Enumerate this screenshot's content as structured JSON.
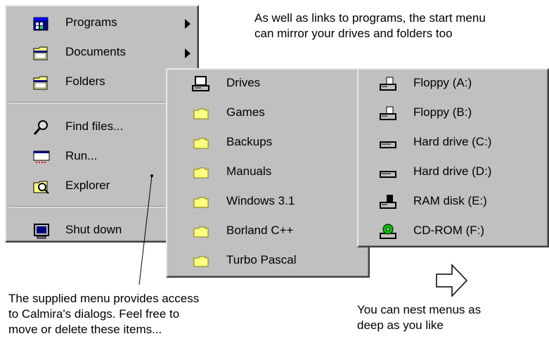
{
  "start_menu": {
    "items": [
      {
        "label": "Programs",
        "icon": "programs-icon"
      },
      {
        "label": "Documents",
        "icon": "documents-icon"
      },
      {
        "label": "Folders",
        "icon": "folders-icon"
      },
      {
        "label": "Find files...",
        "icon": "find-icon"
      },
      {
        "label": "Run...",
        "icon": "run-icon"
      },
      {
        "label": "Explorer",
        "icon": "explorer-icon"
      },
      {
        "label": "Shut down",
        "icon": "shutdown-icon"
      }
    ]
  },
  "folders_menu": {
    "items": [
      {
        "label": "Drives",
        "icon": "drives-icon"
      },
      {
        "label": "Games",
        "icon": "folder-icon"
      },
      {
        "label": "Backups",
        "icon": "folder-icon"
      },
      {
        "label": "Manuals",
        "icon": "folder-icon"
      },
      {
        "label": "Windows 3.1",
        "icon": "folder-icon"
      },
      {
        "label": "Borland C++",
        "icon": "folder-icon"
      },
      {
        "label": "Turbo Pascal",
        "icon": "folder-icon"
      }
    ]
  },
  "drives_menu": {
    "items": [
      {
        "label": "Floppy (A:)",
        "icon": "floppy-drive-icon"
      },
      {
        "label": "Floppy (B:)",
        "icon": "floppy-drive-icon"
      },
      {
        "label": "Hard drive (C:)",
        "icon": "hard-drive-icon"
      },
      {
        "label": "Hard drive (D:)",
        "icon": "hard-drive-icon"
      },
      {
        "label": "RAM disk (E:)",
        "icon": "ram-disk-icon"
      },
      {
        "label": "CD-ROM (F:)",
        "icon": "cdrom-icon"
      }
    ]
  },
  "annotations": {
    "top_right": [
      "As well as links to programs, the start menu",
      "can mirror your drives and folders too"
    ],
    "bottom_left": [
      "The supplied menu provides access",
      "to Calmira's dialogs.  Feel free to",
      "move or delete these items..."
    ],
    "bottom_right": [
      "You can nest menus as",
      "deep as you like"
    ]
  }
}
